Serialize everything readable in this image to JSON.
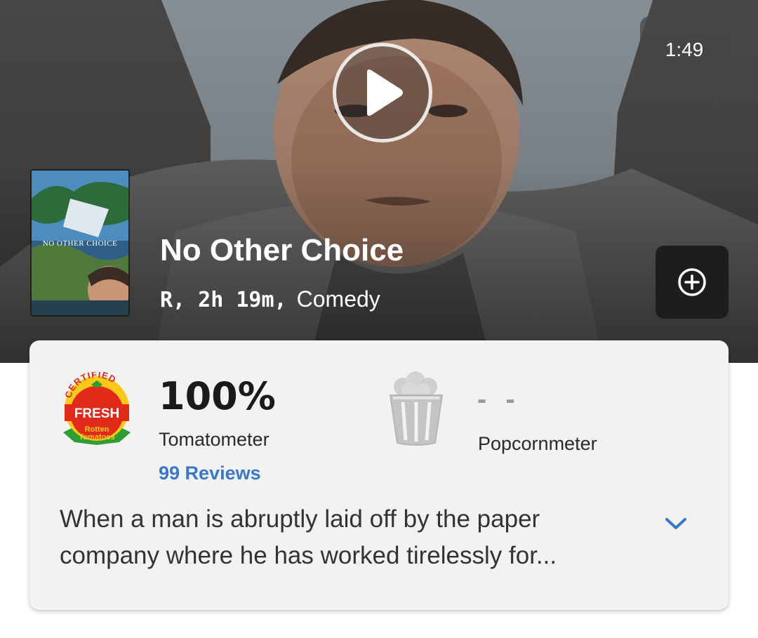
{
  "video": {
    "duration": "1:49"
  },
  "movie": {
    "poster_caption": "NO OTHER CHOICE",
    "title": "No Other Choice",
    "rating_runtime": "R, 2h 19m,",
    "genre": "Comedy"
  },
  "scores": {
    "badge": {
      "top": "CERTIFIED",
      "middle": "FRESH",
      "bottom_line1": "Rotten",
      "bottom_line2": "Tomatoes"
    },
    "tomatometer": {
      "value": "100%",
      "label": "Tomatometer",
      "reviews": "99 Reviews"
    },
    "popcornmeter": {
      "value": "- -",
      "label": "Popcornmeter"
    }
  },
  "synopsis": "When a man is abruptly laid off by the paper company where he has worked tirelessly for...",
  "icons": {
    "play": "play-icon",
    "add": "plus-circle-icon",
    "popcorn": "popcorn-bucket-icon",
    "expand": "chevron-down-icon"
  },
  "colors": {
    "link": "#3a78c9",
    "fresh_red": "#e02a1a",
    "fresh_yellow": "#f8c91a",
    "fresh_green": "#2e9d33"
  }
}
